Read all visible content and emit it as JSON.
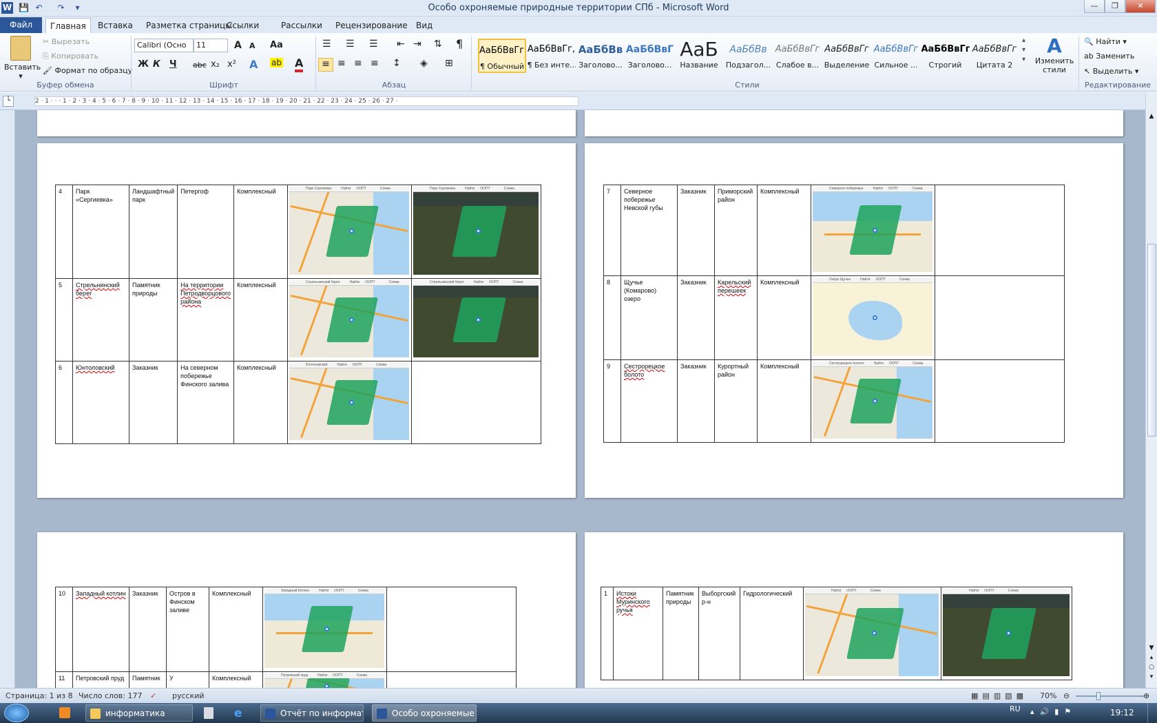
{
  "window": {
    "title": "Особо охроняемые природные территории СПб  -  Microsoft Word",
    "minimize": "—",
    "maximize": "❐",
    "close": "✕"
  },
  "qat": {
    "word_logo": "W",
    "save": "💾",
    "undo": "↶",
    "redo": "↷",
    "customize": "▾"
  },
  "tabs": [
    {
      "label": "Файл"
    },
    {
      "label": "Главная"
    },
    {
      "label": "Вставка"
    },
    {
      "label": "Разметка страницы"
    },
    {
      "label": "Ссылки"
    },
    {
      "label": "Рассылки"
    },
    {
      "label": "Рецензирование"
    },
    {
      "label": "Вид"
    }
  ],
  "ribbon": {
    "clipboard": {
      "label": "Буфер обмена",
      "paste": "Вставить",
      "cut": "Вырезать",
      "copy": "Копировать",
      "format_painter": "Формат по образцу"
    },
    "font": {
      "label": "Шрифт",
      "font_name": "Calibri (Осно",
      "font_size": "11",
      "grow": "A",
      "shrink": "A",
      "case": "Aa",
      "bold": "Ж",
      "italic": "К",
      "underline": "Ч",
      "strike": "abc",
      "sub": "x₂",
      "sup": "x²",
      "effects": "A",
      "highlight": "ab",
      "color": "A"
    },
    "paragraph": {
      "label": "Абзац",
      "pilcrow": "¶"
    },
    "styles": {
      "label": "Стили",
      "items": [
        {
          "sample": "АаБбВвГг,",
          "name": "¶ Обычный"
        },
        {
          "sample": "АаБбВвГг,",
          "name": "¶ Без инте..."
        },
        {
          "sample": "АаБбВв",
          "name": "Заголово..."
        },
        {
          "sample": "АаБбВвГ",
          "name": "Заголово..."
        },
        {
          "sample": "АаБ",
          "name": "Название"
        },
        {
          "sample": "АаБбВв",
          "name": "Подзагол..."
        },
        {
          "sample": "АаБбВвГг",
          "name": "Слабое в..."
        },
        {
          "sample": "АаБбВвГг",
          "name": "Выделение"
        },
        {
          "sample": "АаБбВвГг",
          "name": "Сильное ..."
        },
        {
          "sample": "АаБбВвГг,",
          "name": "Строгий"
        },
        {
          "sample": "АаБбВвГг",
          "name": "Цитата 2"
        }
      ],
      "change_styles": "Изменить стили"
    },
    "editing": {
      "label": "Редактирование",
      "find": "Найти",
      "replace": "Заменить",
      "select": "Выделить"
    }
  },
  "ruler": {
    "marks": "2 · 1 · · · 1 · 2 · 3 · 4 · 5 · 6 · 7 · 8 · 9 · 10 · 11 · 12 · 13 · 14 · 15 · 16 · 17 · 18 · 19 · 20 · 21 · 22 · 23 · 24 · 25 · 26 · 27 ·"
  },
  "tables": {
    "page1": [
      {
        "n": "4",
        "name": "Парк «Сергиевка»",
        "type": "Ландшафтный парк",
        "loc": "Петергоф",
        "profile": "Комплексный",
        "map1": "Парк Сергиевка",
        "map2": "Парк Сергиевка"
      },
      {
        "n": "5",
        "name": "Стрельнинский берег",
        "type": "Памятник природы",
        "loc": "На территории Петродворцового района",
        "profile": "Комплексный",
        "map1": "Стрельнинский берег",
        "map2": "Стрельнинский берег"
      },
      {
        "n": "6",
        "name": "Юнтоловский",
        "type": "Заказник",
        "loc": "На северном побережье Финского залива",
        "profile": "Комплексный",
        "map1": "Юнтоловский"
      }
    ],
    "page2": [
      {
        "n": "7",
        "name": "Северное побережье Невской губы",
        "type": "Заказник",
        "loc": "Приморский район",
        "profile": "Комплексный",
        "map1": "Северное побережье"
      },
      {
        "n": "8",
        "name": "Щучье (Комарово) озеро",
        "type": "Заказник",
        "loc": "Карельский перешеек",
        "profile": "Комплексный",
        "map1": "Озеро Щучье"
      },
      {
        "n": "9",
        "name": "Сестрорецкое болото",
        "type": "Заказник",
        "loc": "Курортный район",
        "profile": "Комплексный",
        "map1": "Сестрорецкое болото"
      }
    ],
    "page3": [
      {
        "n": "10",
        "name": "Западный котлин",
        "type": "Заказник",
        "loc": "Остров в Финском заливе",
        "profile": "Комплексный",
        "map1": "Западный Котлин"
      },
      {
        "n": "11",
        "name": "Петровский пруд",
        "type": "Памятник",
        "loc": "У",
        "profile": "Комплексный",
        "map1": "Петровский пруд"
      }
    ],
    "page4": [
      {
        "n": "1",
        "name": "Истоки Муринского ручья",
        "type": "Памятник природы",
        "loc": "Выборгский р-н",
        "profile": "Гидрологический"
      }
    ]
  },
  "map_ui": {
    "find": "Найти",
    "oopt": "ООПТ",
    "layers": "Схема"
  },
  "status": {
    "page": "Страница: 1 из 8",
    "words": "Число слов: 177",
    "lang": "русский",
    "zoom": "70%"
  },
  "taskbar": {
    "items": [
      {
        "label": "информатика"
      },
      {
        "label": "Отчёт по информат..."
      },
      {
        "label": "Особо охроняемые ..."
      }
    ],
    "lang": "RU",
    "time": "19:12"
  },
  "colors": {
    "file_tab": "#2b579a",
    "park": "#1fa35c",
    "water": "#a9d3f0"
  }
}
